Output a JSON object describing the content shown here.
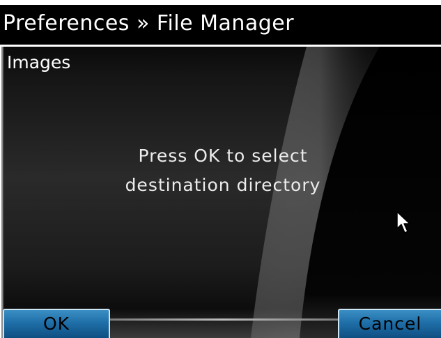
{
  "header": {
    "title": "Preferences » File Manager"
  },
  "main": {
    "section_label": "Images",
    "message_line1": "Press OK to select",
    "message_line2": "destination directory"
  },
  "softkeys": {
    "ok_label": "OK",
    "cancel_label": "Cancel"
  },
  "colors": {
    "softkey_blue": "#1f6fa8",
    "title_bg": "#000000",
    "text": "#ffffff"
  },
  "icons": {
    "cursor": "mouse-pointer-icon"
  }
}
